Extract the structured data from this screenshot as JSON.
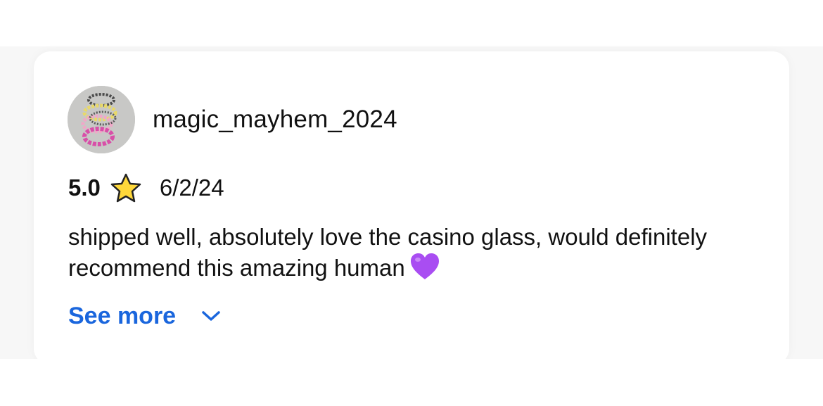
{
  "review": {
    "username": "magic_mayhem_2024",
    "rating": "5.0",
    "date": "6/2/24",
    "text": "shipped well, absolutely love the casino glass, would definitely recommend this amazing human",
    "see_more_label": "See more"
  },
  "icons": {
    "star": "star-icon",
    "heart": "purple-heart-icon",
    "chevron": "chevron-down-icon"
  },
  "colors": {
    "link": "#1a66dd",
    "text": "#111111",
    "star_fill": "#ffd83a",
    "heart_fill": "#a94df2"
  }
}
